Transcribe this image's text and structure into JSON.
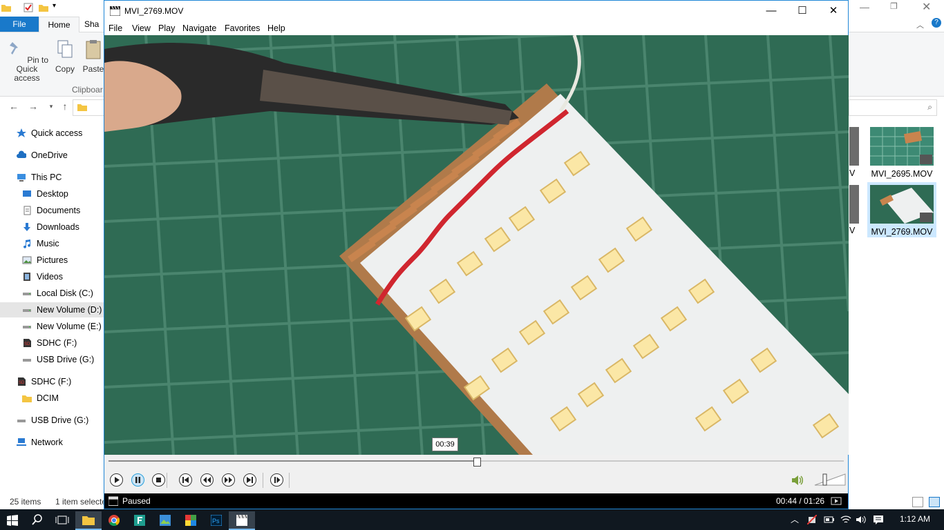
{
  "explorer": {
    "ribbon_tabs": [
      "File",
      "Home",
      "Sha"
    ],
    "ribbon_buttons": {
      "pin": "Pin to Quick access",
      "copy": "Copy",
      "paste": "Paste"
    },
    "clipboard_label": "Clipboar",
    "nav_pane": [
      {
        "label": "Quick access",
        "icon": "star-icon"
      },
      {
        "label": "OneDrive",
        "icon": "cloud-icon"
      },
      {
        "label": "This PC",
        "icon": "computer-icon"
      },
      {
        "label": "Desktop",
        "icon": "desktop-icon"
      },
      {
        "label": "Documents",
        "icon": "document-icon"
      },
      {
        "label": "Downloads",
        "icon": "download-icon"
      },
      {
        "label": "Music",
        "icon": "music-icon"
      },
      {
        "label": "Pictures",
        "icon": "pictures-icon"
      },
      {
        "label": "Videos",
        "icon": "videos-icon"
      },
      {
        "label": "Local Disk (C:)",
        "icon": "drive-icon"
      },
      {
        "label": "New Volume (D:)",
        "icon": "drive-icon"
      },
      {
        "label": "New Volume (E:)",
        "icon": "drive-icon"
      },
      {
        "label": "SDHC (F:)",
        "icon": "sd-card-icon"
      },
      {
        "label": "USB Drive (G:)",
        "icon": "usb-drive-icon"
      },
      {
        "label": "SDHC (F:)",
        "icon": "sd-card-icon"
      },
      {
        "label": "DCIM",
        "icon": "folder-icon"
      },
      {
        "label": "USB Drive (G:)",
        "icon": "usb-drive-icon"
      },
      {
        "label": "Network",
        "icon": "network-icon"
      }
    ],
    "files": [
      {
        "name": "MVI_2695.MOV"
      },
      {
        "name": "MVI_2769.MOV"
      }
    ],
    "partial_captions": [
      "V",
      "V"
    ],
    "status": {
      "items": "25 items",
      "selected": "1 item selecte"
    }
  },
  "player": {
    "title": "MVI_2769.MOV",
    "menu": [
      "File",
      "View",
      "Play",
      "Navigate",
      "Favorites",
      "Help"
    ],
    "seek_tooltip": "00:39",
    "progress_fraction": 0.5,
    "status": "Paused",
    "time": "00:44 / 01:26"
  },
  "taskbar": {
    "clock": "1:12 AM",
    "apps": [
      "file-explorer-icon",
      "chrome-icon",
      "app-f-icon",
      "photos-icon",
      "paint-icon",
      "photoshop-icon",
      "media-player-icon"
    ]
  },
  "colors": {
    "accent": "#1979ca",
    "taskbar": "#101820",
    "mat_green": "#2f6b54",
    "board_white": "#eef0f0",
    "pcb_copper": "#c8844e",
    "wire_red": "#d0262f"
  }
}
